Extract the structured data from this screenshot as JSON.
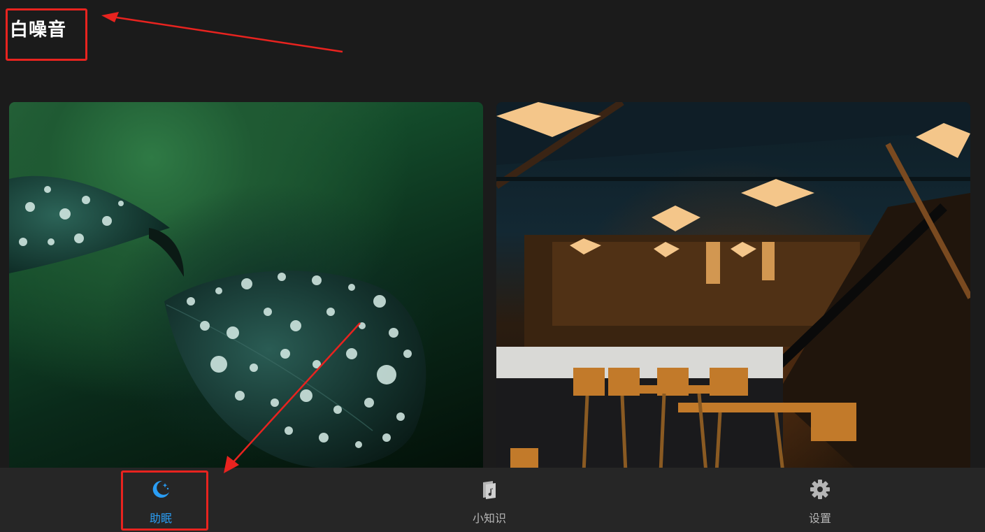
{
  "header": {
    "title": "白噪音"
  },
  "cards": [
    {
      "name": "rain-leaf-card"
    },
    {
      "name": "cafe-card"
    }
  ],
  "tabs": [
    {
      "label": "助眠",
      "icon": "moon-icon",
      "active": true
    },
    {
      "label": "小知识",
      "icon": "book-icon",
      "active": false
    },
    {
      "label": "设置",
      "icon": "gear-icon",
      "active": false
    }
  ],
  "colors": {
    "background": "#1b1b1b",
    "tab_bar": "#262626",
    "accent": "#2a9df4",
    "inactive": "#b5b5b5",
    "annotation": "#e8231f"
  }
}
